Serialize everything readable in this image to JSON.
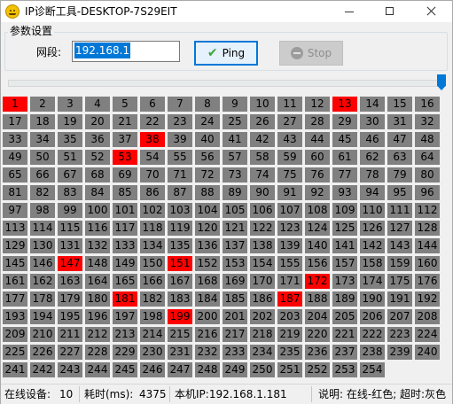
{
  "window": {
    "title": "IP诊断工具-DESKTOP-7S29EIT"
  },
  "settings": {
    "group_label": "参数设置",
    "segment_label": "网段:",
    "segment_value": "192.168.1",
    "ping_label": "Ping",
    "stop_label": "Stop"
  },
  "slider": {
    "value_fraction": 1.0
  },
  "colors": {
    "online": "#ff0000",
    "offline": "#808080",
    "accent": "#0078d7"
  },
  "ip_grid": {
    "start": 1,
    "end": 254,
    "online": [
      1,
      13,
      38,
      53,
      147,
      151,
      172,
      181,
      187,
      199
    ]
  },
  "status": {
    "online_label": "在线设备:",
    "online_count": "10",
    "time_label": "耗时(ms):",
    "time_value": "4375",
    "local_ip": "本机IP:192.168.1.181",
    "legend": "说明: 在线-红色; 超时:灰色"
  }
}
